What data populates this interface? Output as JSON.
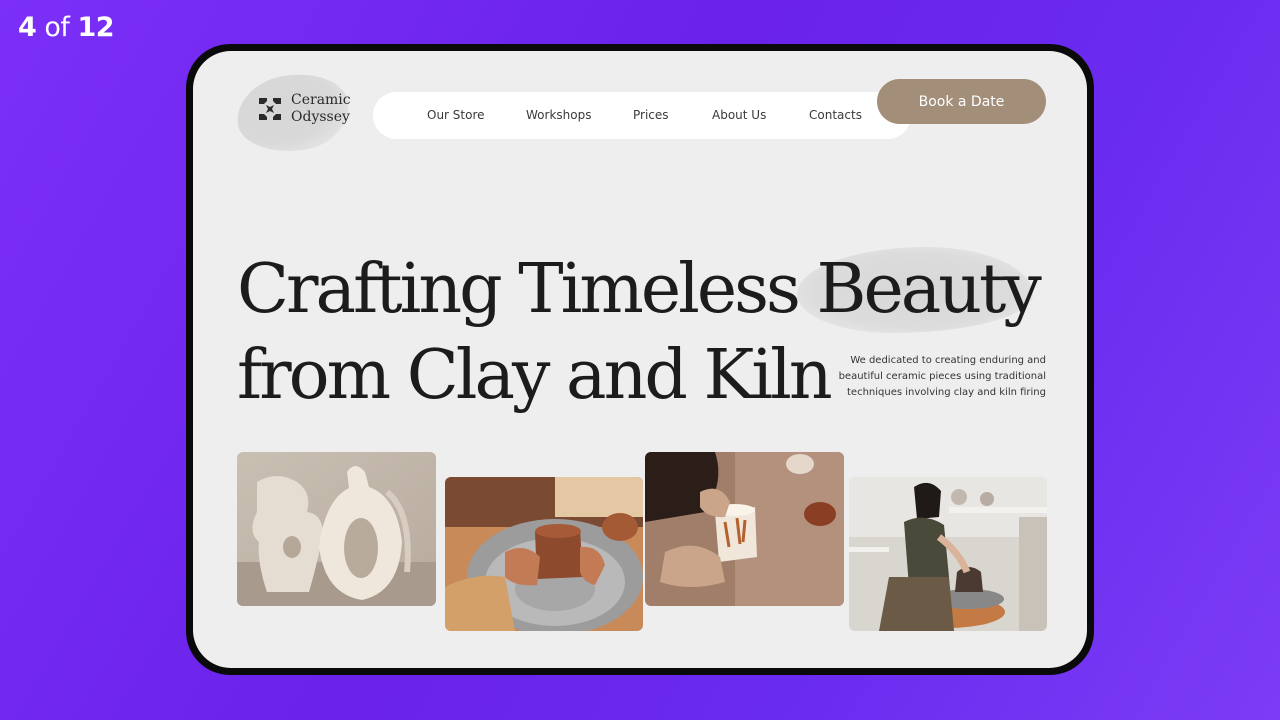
{
  "slide_counter": {
    "current": "4",
    "of": "of",
    "total": "12"
  },
  "brand": {
    "name_line1": "Ceramic",
    "name_line2": "Odyssey"
  },
  "nav": {
    "items": [
      "Our Store",
      "Workshops",
      "Prices",
      "About Us",
      "Contacts"
    ]
  },
  "cta": {
    "book_label": "Book a Date"
  },
  "hero": {
    "title_line1": "Crafting Timeless Beauty",
    "title_line2": "from Clay and Kiln",
    "description": "We dedicated to creating enduring and beautiful ceramic pieces using traditional techniques involving clay and kiln firing"
  },
  "colors": {
    "background": "#6a22e8",
    "screen": "#eeeeee",
    "accent": "#a28e79",
    "text": "#1c1c1c"
  },
  "photos": [
    {
      "icon": "white-vases-photo"
    },
    {
      "icon": "pottery-wheel-hands-photo"
    },
    {
      "icon": "painting-mug-photo"
    },
    {
      "icon": "woman-pottery-wheel-photo"
    }
  ]
}
